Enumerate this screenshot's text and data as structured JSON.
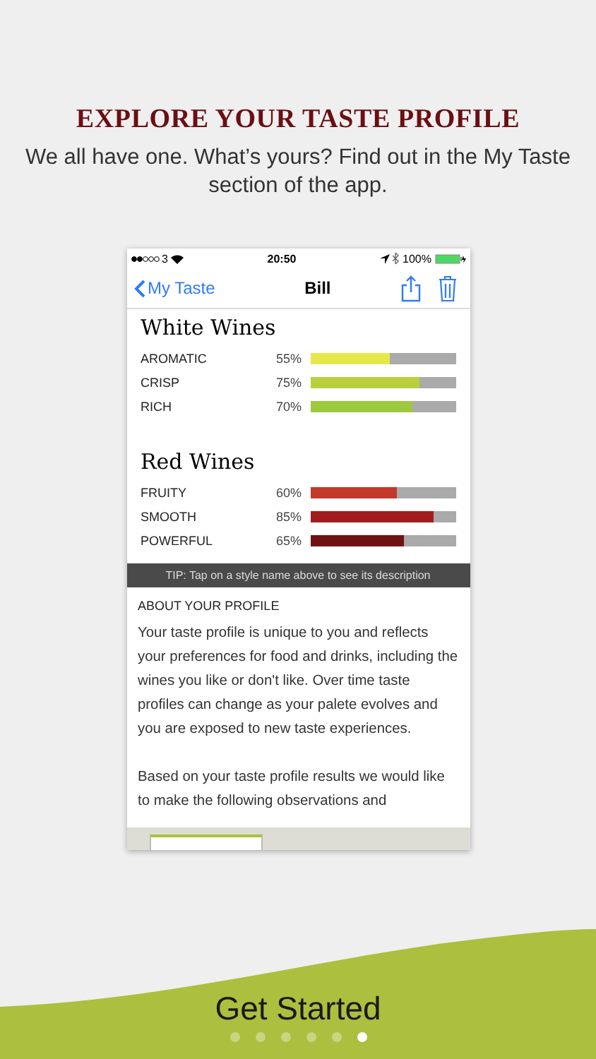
{
  "headline": "EXPLORE YOUR TASTE PROFILE",
  "subtitle": "We all have one. What’s yours? Find out in the My Taste section of the app.",
  "phone": {
    "status_bar": {
      "carrier": "3",
      "time": "20:50",
      "battery": "100%"
    },
    "nav": {
      "back": "My Taste",
      "title": "Bill"
    },
    "sections": [
      {
        "title": "White Wines",
        "styles": [
          {
            "name": "AROMATIC",
            "reading": "55%",
            "level": 0.55,
            "color": "#e6e84a"
          },
          {
            "name": "CRISP",
            "reading": "75%",
            "level": 0.75,
            "color": "#b9cf3c"
          },
          {
            "name": "RICH",
            "reading": "70%",
            "level": 0.7,
            "color": "#9ec93e"
          }
        ]
      },
      {
        "title": "Red Wines",
        "styles": [
          {
            "name": "FRUITY",
            "reading": "60%",
            "level": 0.6,
            "color": "#c2392a"
          },
          {
            "name": "SMOOTH",
            "reading": "85%",
            "level": 0.85,
            "color": "#a11d1d"
          },
          {
            "name": "POWERFUL",
            "reading": "65%",
            "level": 0.65,
            "color": "#6e1212"
          }
        ]
      }
    ],
    "tip": "TIP: Tap on a style name above to see its description",
    "about_heading": "ABOUT YOUR PROFILE",
    "paragraphs": [
      "Your taste profile is unique to you and reflects your preferences for food and drinks, including the wines you like or don't like. Over time taste profiles can change as your palete evolves and you are exposed to new taste experiences.",
      "Based on your taste profile results we would like to make the following observations and"
    ]
  },
  "button": "Get Started",
  "pages": [
    {
      "selected": false
    },
    {
      "selected": false
    },
    {
      "selected": false
    },
    {
      "selected": false
    },
    {
      "selected": false
    },
    {
      "selected": true
    }
  ]
}
